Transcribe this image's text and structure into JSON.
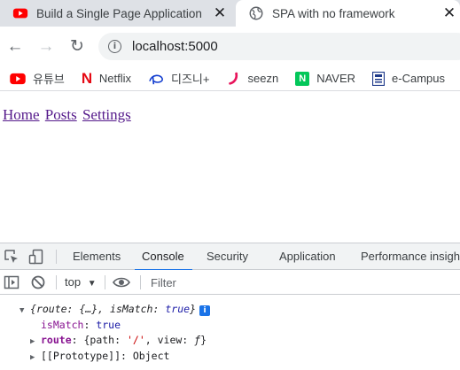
{
  "browser": {
    "tabs": [
      {
        "title": "Build a Single Page Application",
        "icon": "youtube-icon",
        "active": false
      },
      {
        "title": "SPA with no framework",
        "icon": "globe-icon",
        "active": true
      }
    ],
    "close_glyph": "✕",
    "nav": {
      "back": "←",
      "forward": "→",
      "reload": "↻"
    },
    "address": "localhost:5000",
    "bookmarks": [
      {
        "label": "유튜브",
        "icon": "youtube-icon"
      },
      {
        "label": "Netflix",
        "icon": "netflix-icon",
        "glyph": "N"
      },
      {
        "label": "디즈니+",
        "icon": "disney-plus-icon"
      },
      {
        "label": "seezn",
        "icon": "seezn-icon"
      },
      {
        "label": "NAVER",
        "icon": "naver-icon",
        "glyph": "N"
      },
      {
        "label": "e-Campus",
        "icon": "ecampus-icon"
      }
    ]
  },
  "page": {
    "links": [
      "Home",
      "Posts",
      "Settings"
    ]
  },
  "devtools": {
    "tabs": [
      "Elements",
      "Console",
      "Security",
      "Application",
      "Performance insights"
    ],
    "active_tab": "Console",
    "context": "top",
    "context_caret": "▼",
    "filter_placeholder": "Filter",
    "log": {
      "summary_open": "{",
      "summary_route": "route: {…}, isMatch:",
      "summary_true": "true",
      "summary_close": "}",
      "info_badge": "i",
      "ismatch_key": "isMatch",
      "ismatch_value": "true",
      "route_key": "route",
      "route_prefix": "{path:",
      "route_path": "'/'",
      "route_view_key": ", view:",
      "route_view_value": "ƒ",
      "route_close": "}",
      "proto_key": "[[Prototype]]",
      "proto_value": "Object"
    }
  },
  "colors": {
    "link_visited": "#551a8b",
    "devtools_accent": "#1a73e8"
  }
}
